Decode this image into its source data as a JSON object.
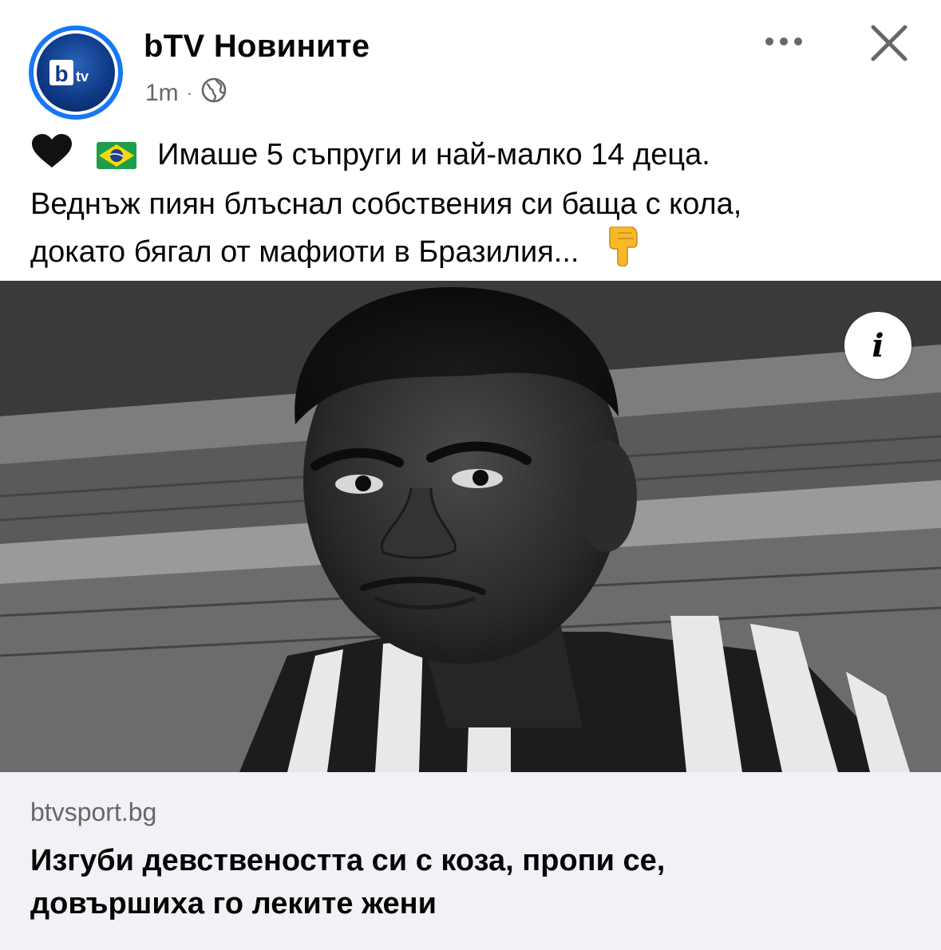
{
  "post": {
    "page_name": "bTV Новините",
    "avatar_logo_text": "btv",
    "time": "1m",
    "separator": "·",
    "privacy_icon": "globe-icon",
    "more_icon": "more-horizontal-icon",
    "close_icon": "close-icon",
    "caption": {
      "line1": "Имаше 5 съпруги и най-малко 14 деца.",
      "line2": "Веднъж пиян блъснал собствения си баща с кола,",
      "line3": "докато бягал от мафиоти в Бразилия...",
      "emoji_heart": "black-heart-icon",
      "emoji_flag": "brazil-flag-icon",
      "emoji_point": "pointing-down-icon"
    }
  },
  "image": {
    "alt": "black-and-white-portrait-photo",
    "info_label": "i"
  },
  "link_preview": {
    "domain": "btvsport.bg",
    "headline_line1": "Изгуби девствеността си с коза, пропи се,",
    "headline_line2": "довършиха го леките жени"
  },
  "colors": {
    "accent": "#1877f2",
    "secondary_text": "#65676b",
    "link_bg": "#f0f2f5"
  }
}
